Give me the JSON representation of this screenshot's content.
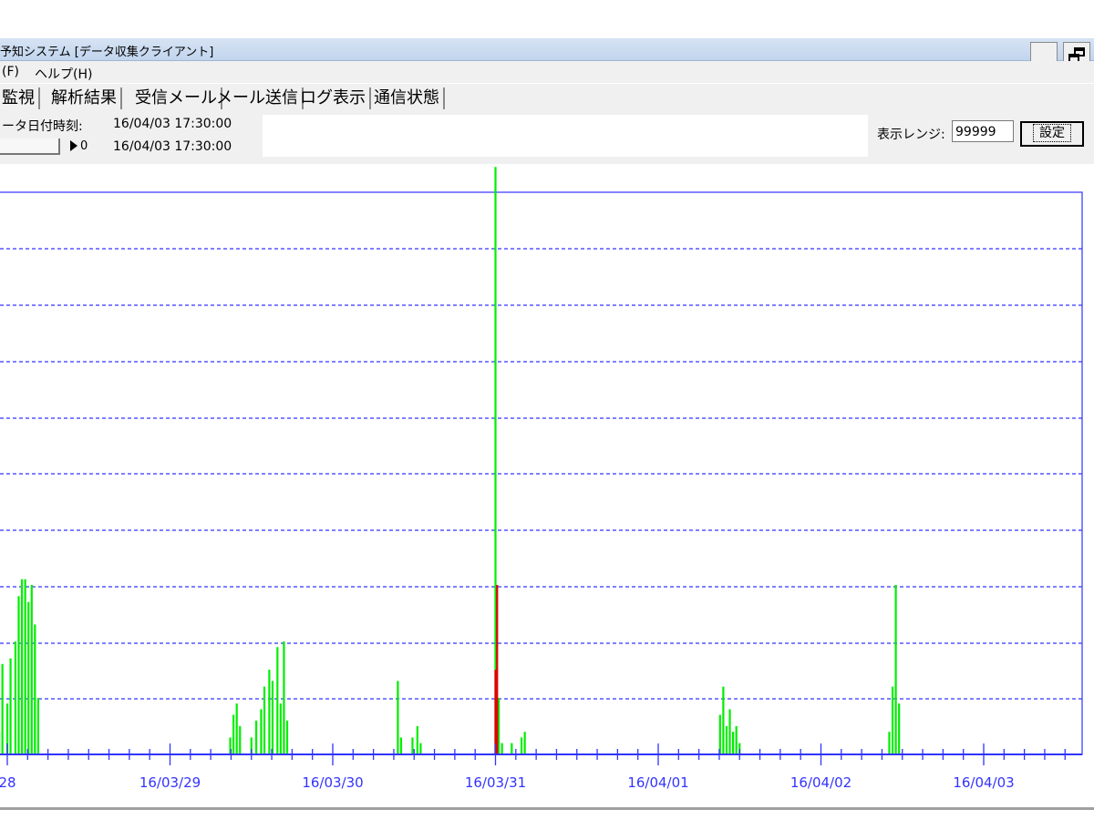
{
  "window": {
    "title": "予知システム [データ収集クライアント]"
  },
  "menu": [
    {
      "label": "(F)"
    },
    {
      "label": "ヘルプ(H)"
    }
  ],
  "tabs": [
    {
      "label": "監視"
    },
    {
      "label": "解析結果"
    },
    {
      "label": "受信メール"
    },
    {
      "label": "メール送信"
    },
    {
      "label": "ログ表示"
    },
    {
      "label": "通信状態"
    }
  ],
  "info": {
    "datetime_label": "ータ日付時刻:",
    "datetime_value": "16/04/03 17:30:00",
    "slider_value": "0",
    "slider_datetime": "16/04/03 17:30:00",
    "range_label": "表示レンジ:",
    "range_value": "99999",
    "set_button": "設定"
  },
  "colors": {
    "axis": "#3333ff",
    "grid": "#3333ff",
    "series_main": "#00ee00",
    "series_alert": "#e00000",
    "window_bg": "#f0f0f0"
  },
  "chart_data": {
    "type": "bar",
    "title": "",
    "xlabel": "",
    "ylabel": "",
    "x_tick_labels": [
      "28",
      "16/03/29",
      "16/03/30",
      "16/03/31",
      "16/04/01",
      "16/04/02",
      "16/04/03"
    ],
    "y_gridlines": 9,
    "ylim": [
      0,
      10
    ],
    "grid": "horizontal-dashed",
    "series": [
      {
        "color": "#00ee00",
        "points": [
          [
            27.95,
            0.4
          ],
          [
            27.97,
            1.6
          ],
          [
            28.0,
            0.9
          ],
          [
            28.02,
            1.7
          ],
          [
            28.05,
            2.0
          ],
          [
            28.07,
            2.8
          ],
          [
            28.09,
            3.1
          ],
          [
            28.11,
            3.1
          ],
          [
            28.13,
            2.7
          ],
          [
            28.15,
            3.0
          ],
          [
            28.17,
            2.3
          ],
          [
            28.19,
            1.0
          ],
          [
            29.37,
            0.3
          ],
          [
            29.39,
            0.7
          ],
          [
            29.41,
            0.9
          ],
          [
            29.43,
            0.5
          ],
          [
            29.5,
            0.3
          ],
          [
            29.53,
            0.6
          ],
          [
            29.56,
            0.8
          ],
          [
            29.58,
            1.2
          ],
          [
            29.61,
            1.5
          ],
          [
            29.63,
            1.3
          ],
          [
            29.66,
            1.9
          ],
          [
            29.68,
            0.9
          ],
          [
            29.7,
            2.0
          ],
          [
            29.72,
            0.6
          ],
          [
            30.4,
            1.3
          ],
          [
            30.42,
            0.3
          ],
          [
            30.49,
            0.3
          ],
          [
            30.52,
            0.5
          ],
          [
            30.54,
            0.2
          ],
          [
            31.0,
            10.4
          ],
          [
            31.02,
            1.0
          ],
          [
            31.04,
            0.2
          ],
          [
            31.1,
            0.2
          ],
          [
            31.16,
            0.3
          ],
          [
            31.18,
            0.4
          ],
          [
            32.38,
            0.7
          ],
          [
            32.4,
            1.2
          ],
          [
            32.42,
            0.5
          ],
          [
            32.44,
            0.8
          ],
          [
            32.46,
            0.4
          ],
          [
            32.48,
            0.5
          ],
          [
            32.5,
            0.2
          ],
          [
            33.42,
            0.4
          ],
          [
            33.44,
            1.2
          ],
          [
            33.46,
            3.0
          ],
          [
            33.48,
            0.9
          ]
        ]
      },
      {
        "color": "#e00000",
        "points": [
          [
            31.0,
            1.5
          ],
          [
            31.01,
            3.0
          ]
        ]
      }
    ]
  }
}
